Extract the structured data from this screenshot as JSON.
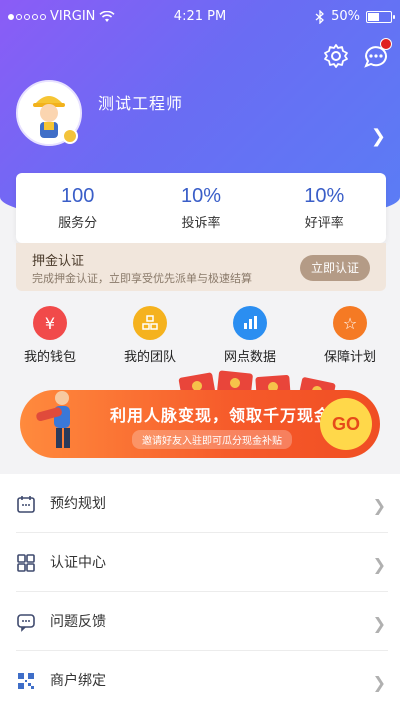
{
  "statusbar": {
    "carrier": "VIRGIN",
    "time": "4:21 PM",
    "battery": "50%"
  },
  "profile": {
    "name": "测试工程师"
  },
  "stats": [
    {
      "value": "100",
      "label": "服务分"
    },
    {
      "value": "10%",
      "label": "投诉率"
    },
    {
      "value": "10%",
      "label": "好评率"
    }
  ],
  "deposit": {
    "title": "押金认证",
    "desc": "完成押金认证，立即享受优先派单与极速结算",
    "button": "立即认证"
  },
  "quick": [
    {
      "label": "我的钱包",
      "icon": "wallet-icon",
      "color": "#f14a4a",
      "glyph": "¥"
    },
    {
      "label": "我的团队",
      "icon": "team-icon",
      "color": "#f5b21e",
      "glyph": "▦"
    },
    {
      "label": "网点数据",
      "icon": "chart-icon",
      "color": "#2b8ef1",
      "glyph": "▤"
    },
    {
      "label": "保障计划",
      "icon": "star-icon",
      "color": "#f57a24",
      "glyph": "☆"
    }
  ],
  "banner": {
    "main": "利用人脉变现，领取千万现金",
    "sub": "邀请好友入驻即可瓜分现金补贴",
    "go": "GO"
  },
  "menu": [
    {
      "label": "预约规划",
      "icon": "calendar-icon"
    },
    {
      "label": "认证中心",
      "icon": "grid-icon"
    },
    {
      "label": "问题反馈",
      "icon": "feedback-icon"
    },
    {
      "label": "商户绑定",
      "icon": "qrcode-icon"
    }
  ]
}
